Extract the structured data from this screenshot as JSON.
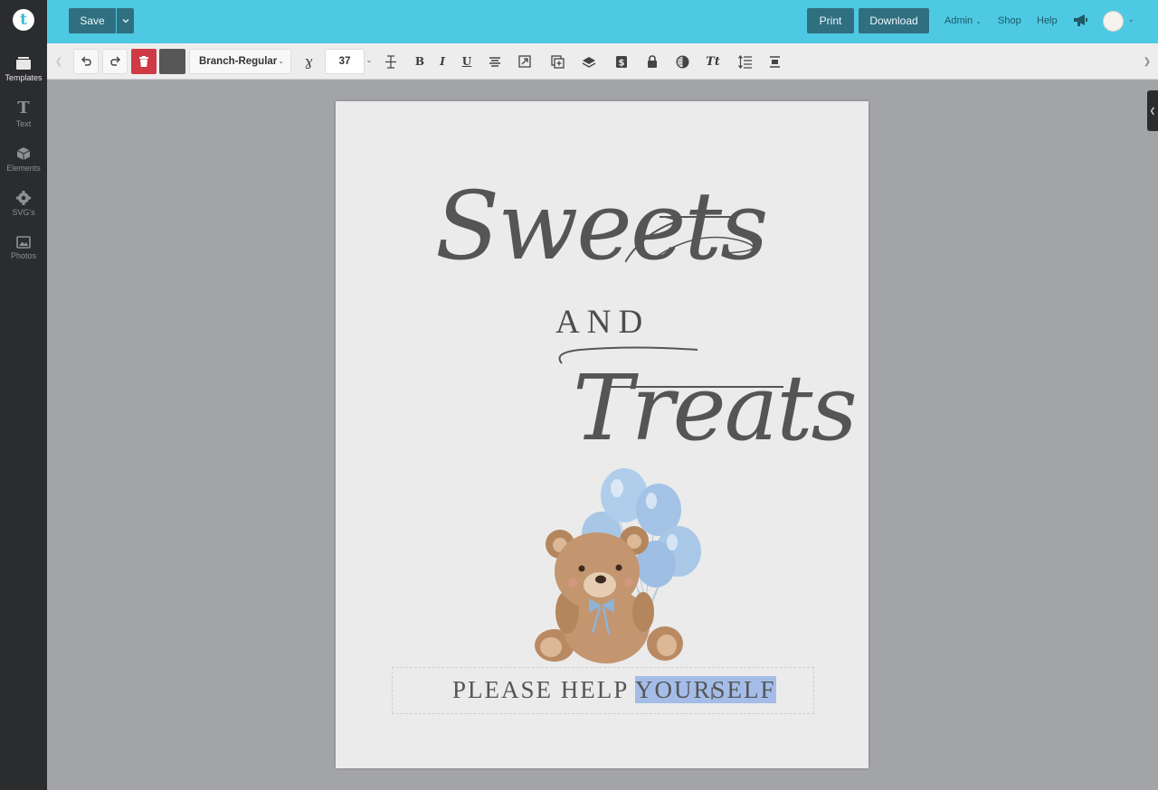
{
  "app": {
    "logo_letter": "t",
    "accent_color": "#4ec9e3"
  },
  "sidebar": {
    "items": [
      {
        "label": "Templates",
        "icon": "templates-icon"
      },
      {
        "label": "Text",
        "icon": "text-icon"
      },
      {
        "label": "Elements",
        "icon": "elements-icon"
      },
      {
        "label": "SVG's",
        "icon": "svg-icon"
      },
      {
        "label": "Photos",
        "icon": "photos-icon"
      }
    ]
  },
  "topbar": {
    "save_label": "Save",
    "print_label": "Print",
    "download_label": "Download",
    "admin_label": "Admin",
    "shop_label": "Shop",
    "help_label": "Help"
  },
  "toolbar": {
    "font_name": "Branch-Regular",
    "font_size": "37",
    "delete_color": "#cf3b44",
    "text_color": "#575757"
  },
  "canvas": {
    "script_word_1": "Sweets",
    "connector": "AND",
    "script_word_2": "Treats",
    "tagline_before": "PLEASE HELP ",
    "tagline_selected": "YOURSELF"
  }
}
